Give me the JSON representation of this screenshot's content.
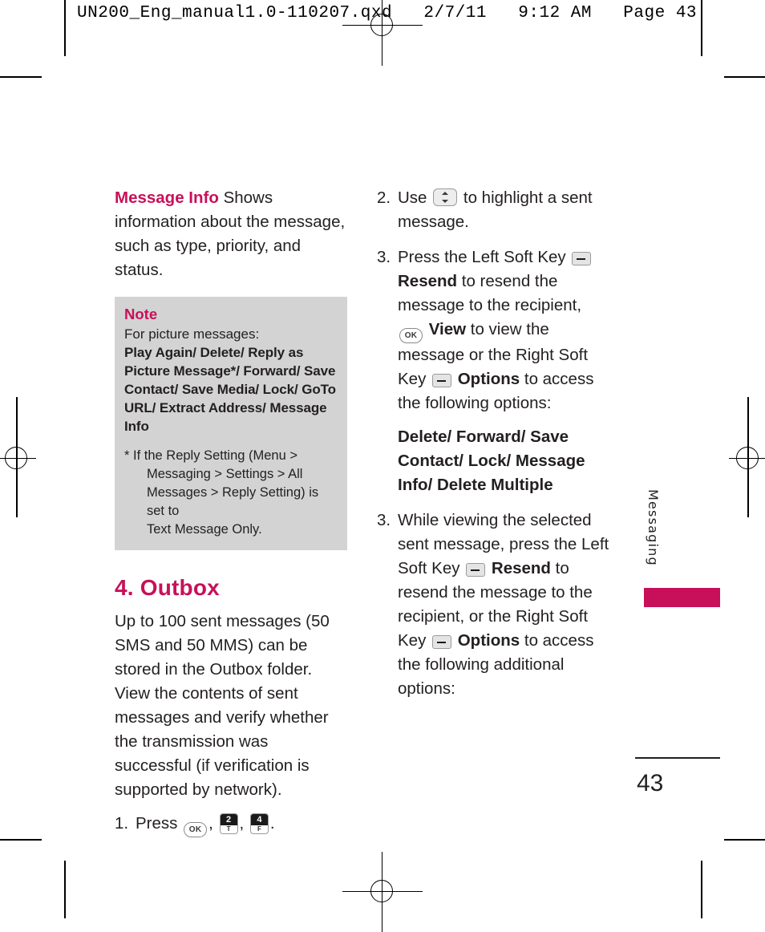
{
  "header": {
    "stamp": "UN200_Eng_manual1.0-110207.qxd   2/7/11   9:12 AM   Page 43"
  },
  "colors": {
    "accent": "#c8105a",
    "note_background": "#d3d3d3",
    "text": "#231f20"
  },
  "left_column": {
    "intro": {
      "term": "Message Info",
      "text": " Shows information about the message, such as type, priority, and status."
    },
    "note": {
      "title": "Note",
      "lead": "For picture messages:",
      "options_list": "Play Again/ Delete/ Reply as Picture Message*/ Forward/ Save Contact/ Save Media/ Lock/ GoTo URL/ Extract Address/ Message Info",
      "footnote_marker": "*",
      "footnote_line1": "If the Reply Setting (Menu >",
      "footnote_line2": "Messaging > Settings > All",
      "footnote_line3": "Messages > Reply Setting) is set to",
      "footnote_line4": "Text Message Only."
    },
    "section": {
      "heading": "4. Outbox",
      "body": "Up to 100 sent messages (50 SMS and 50 MMS) can be stored in the Outbox folder. View the contents of sent messages and verify whether the transmission was successful (if verification is supported by network)."
    },
    "step1": {
      "num": "1.",
      "press_label": "Press",
      "key_ok": "OK",
      "comma1": ",",
      "key2_digit": "2",
      "key2_letter": "T",
      "comma2": ",",
      "key4_digit": "4",
      "key4_letter": "F",
      "period": "."
    }
  },
  "right_column": {
    "step2": {
      "num": "2.",
      "text_before": "Use",
      "key_nav": "up-down-navigation-key",
      "text_after": "to highlight a sent message."
    },
    "step3a": {
      "num": "3.",
      "t1": "Press the Left Soft Key",
      "soft_key_left": "left-soft-key",
      "t2": "Resend",
      "t3": " to resend the message to the recipient, ",
      "key_ok": "OK",
      "t4": "View",
      "t5": " to view the message or the Right Soft Key ",
      "soft_key_right": "right-soft-key",
      "t6": "Options",
      "t7": " to access the following options:",
      "options": "Delete/ Forward/ Save Contact/ Lock/ Message Info/ Delete Multiple"
    },
    "step3b": {
      "num": "3.",
      "t1": "While viewing the selected sent message, press the Left Soft Key ",
      "soft_key_left": "left-soft-key",
      "t2": "Resend",
      "t3": " to resend the message to the recipient, or the Right Soft Key ",
      "soft_key_right": "right-soft-key",
      "t4": "Options",
      "t5": " to access the following additional options:"
    }
  },
  "side_tab": {
    "label": "Messaging"
  },
  "footer": {
    "page_number": "43"
  }
}
